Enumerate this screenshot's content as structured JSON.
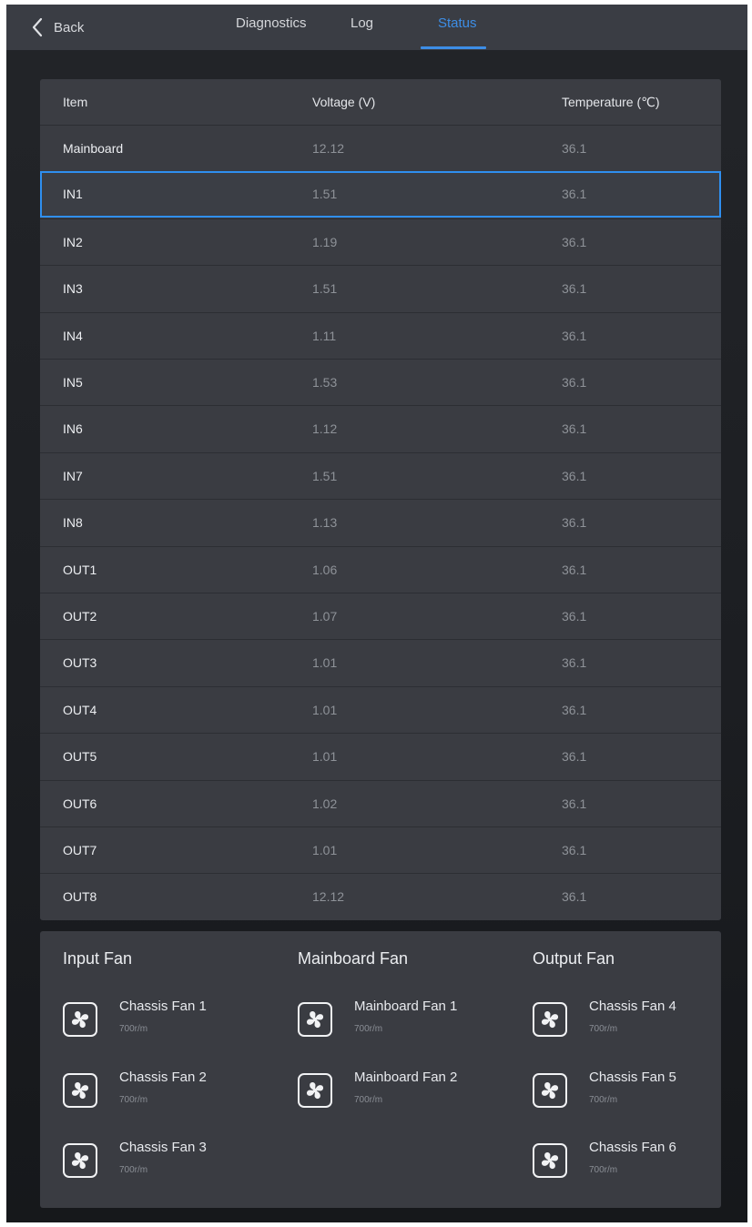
{
  "nav": {
    "back_label": "Back",
    "tabs": [
      {
        "label": "Diagnostics",
        "active": false
      },
      {
        "label": "Log",
        "active": false
      },
      {
        "label": "Status",
        "active": true
      }
    ]
  },
  "table": {
    "columns": [
      "Item",
      "Voltage (V)",
      "Temperature (℃)"
    ],
    "rows": [
      {
        "item": "Mainboard",
        "voltage": "12.12",
        "temperature": "36.1"
      },
      {
        "item": "IN1",
        "voltage": "1.51",
        "temperature": "36.1",
        "selected": true
      },
      {
        "item": "IN2",
        "voltage": "1.19",
        "temperature": "36.1"
      },
      {
        "item": "IN3",
        "voltage": "1.51",
        "temperature": "36.1"
      },
      {
        "item": "IN4",
        "voltage": "1.11",
        "temperature": "36.1"
      },
      {
        "item": "IN5",
        "voltage": "1.53",
        "temperature": "36.1"
      },
      {
        "item": "IN6",
        "voltage": "1.12",
        "temperature": "36.1"
      },
      {
        "item": "IN7",
        "voltage": "1.51",
        "temperature": "36.1"
      },
      {
        "item": "IN8",
        "voltage": "1.13",
        "temperature": "36.1"
      },
      {
        "item": "OUT1",
        "voltage": "1.06",
        "temperature": "36.1"
      },
      {
        "item": "OUT2",
        "voltage": "1.07",
        "temperature": "36.1"
      },
      {
        "item": "OUT3",
        "voltage": "1.01",
        "temperature": "36.1"
      },
      {
        "item": "OUT4",
        "voltage": "1.01",
        "temperature": "36.1"
      },
      {
        "item": "OUT5",
        "voltage": "1.01",
        "temperature": "36.1"
      },
      {
        "item": "OUT6",
        "voltage": "1.02",
        "temperature": "36.1"
      },
      {
        "item": "OUT7",
        "voltage": "1.01",
        "temperature": "36.1"
      },
      {
        "item": "OUT8",
        "voltage": "12.12",
        "temperature": "36.1"
      }
    ]
  },
  "fans": {
    "groups": [
      {
        "title": "Input Fan",
        "items": [
          {
            "name": "Chassis Fan 1",
            "speed": "700r/m",
            "icon": "fan-icon"
          },
          {
            "name": "Chassis Fan 2",
            "speed": "700r/m",
            "icon": "fan-icon"
          },
          {
            "name": "Chassis Fan 3",
            "speed": "700r/m",
            "icon": "fan-icon"
          }
        ]
      },
      {
        "title": "Mainboard Fan",
        "items": [
          {
            "name": "Mainboard Fan 1",
            "speed": "700r/m",
            "icon": "fan-icon"
          },
          {
            "name": "Mainboard Fan 2",
            "speed": "700r/m",
            "icon": "fan-icon"
          }
        ]
      },
      {
        "title": "Output Fan",
        "items": [
          {
            "name": "Chassis Fan 4",
            "speed": "700r/m",
            "icon": "fan-icon"
          },
          {
            "name": "Chassis Fan 5",
            "speed": "700r/m",
            "icon": "fan-icon"
          },
          {
            "name": "Chassis Fan 6",
            "speed": "700r/m",
            "icon": "fan-icon"
          }
        ]
      }
    ]
  },
  "colors": {
    "accent": "#3d8ee6",
    "selection_border": "#2f8ff0",
    "panel": "#3a3c42",
    "topbar": "#3a3d44"
  }
}
